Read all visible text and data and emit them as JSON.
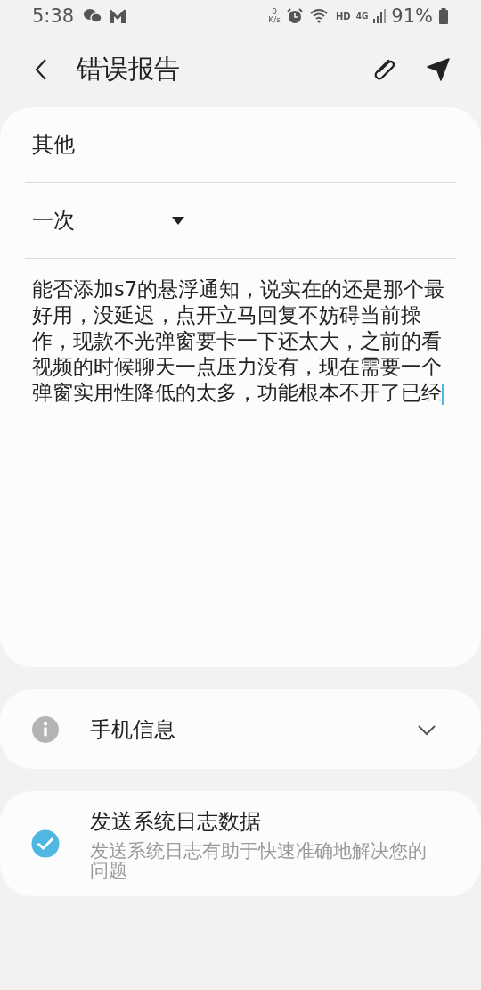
{
  "status_bar": {
    "time": "5:38",
    "network_speed": {
      "value": "0",
      "unit": "K/s"
    },
    "hd_label": "HD",
    "network_type": "4G",
    "battery": "91%"
  },
  "header": {
    "title": "错误报告"
  },
  "form": {
    "category": "其他",
    "frequency": {
      "value": "一次",
      "expanded": false
    },
    "description": "能否添加s7的悬浮通知，说实在的还是那个最好用，没延迟，点开立马回复不妨碍当前操作，现款不光弹窗要卡一下还太大，之前的看视频的时候聊天一点压力没有，现在需要一个弹窗实用性降低的太多，功能根本不开了已经"
  },
  "phone_info": {
    "label": "手机信息",
    "expanded": false
  },
  "send_logs": {
    "title": "发送系统日志数据",
    "subtitle": "发送系统日志有助于快速准确地解决您的问题",
    "checked": true
  }
}
